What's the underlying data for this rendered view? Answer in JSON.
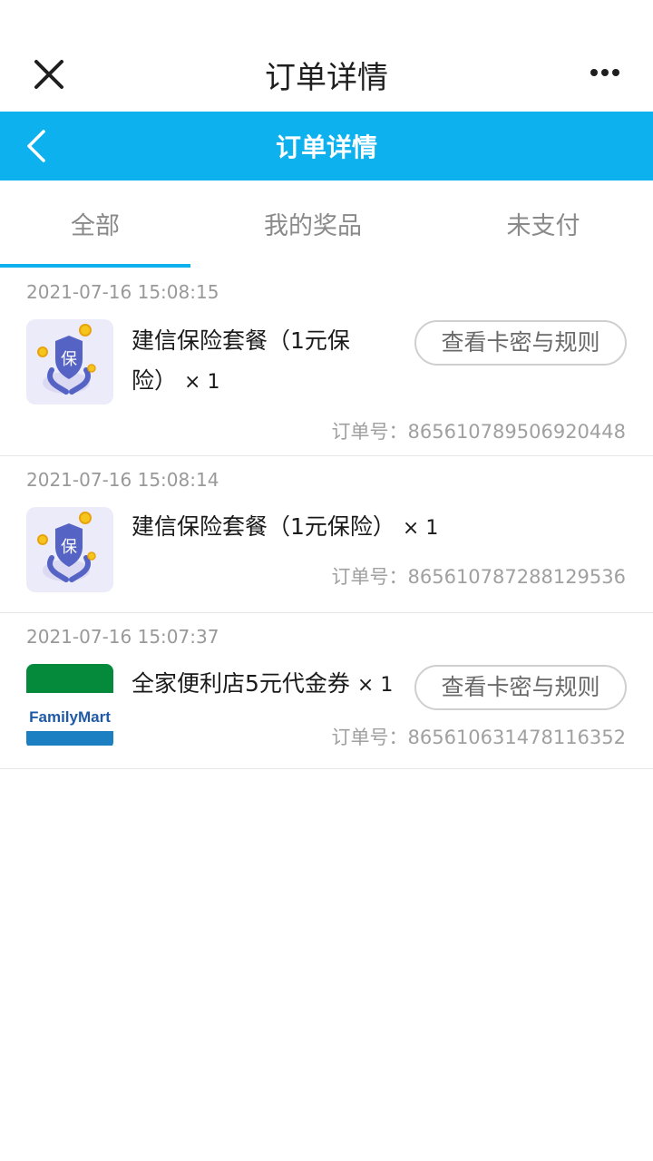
{
  "wechat_bar": {
    "title": "订单详情"
  },
  "app_bar": {
    "title": "订单详情"
  },
  "tabs": [
    {
      "label": "全部",
      "active": true
    },
    {
      "label": "我的奖品",
      "active": false
    },
    {
      "label": "未支付",
      "active": false
    }
  ],
  "orders": [
    {
      "time": "2021-07-16 15:08:15",
      "title_line1": "建信保险套餐（1元保",
      "title_line2": "险）",
      "qty": "× 1",
      "button": "查看卡密与规则",
      "order_no": "订单号：865610789506920448",
      "icon": "insurance-shield-icon"
    },
    {
      "time": "2021-07-16 15:08:14",
      "title_line1": "建信保险套餐（1元保险）",
      "qty": "× 1",
      "order_no": "订单号：865610787288129536",
      "icon": "insurance-shield-icon"
    },
    {
      "time": "2021-07-16 15:07:37",
      "title_line1": "全家便利店5元代金券",
      "qty": "× 1",
      "button": "查看卡密与规则",
      "order_no": "订单号：865610631478116352",
      "logo_text": "FamilyMart",
      "icon": "familymart-logo"
    }
  ],
  "colors": {
    "accent": "#0db1ee",
    "muted": "#999999",
    "border": "#e6e6e6"
  }
}
